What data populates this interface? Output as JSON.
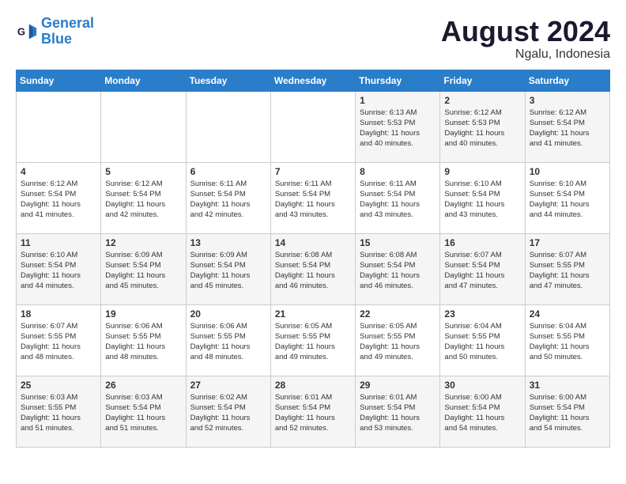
{
  "header": {
    "logo_line1": "General",
    "logo_line2": "Blue",
    "month_title": "August 2024",
    "location": "Ngalu, Indonesia"
  },
  "days_of_week": [
    "Sunday",
    "Monday",
    "Tuesday",
    "Wednesday",
    "Thursday",
    "Friday",
    "Saturday"
  ],
  "weeks": [
    [
      {
        "day": "",
        "info": ""
      },
      {
        "day": "",
        "info": ""
      },
      {
        "day": "",
        "info": ""
      },
      {
        "day": "",
        "info": ""
      },
      {
        "day": "1",
        "info": "Sunrise: 6:13 AM\nSunset: 5:53 PM\nDaylight: 11 hours\nand 40 minutes."
      },
      {
        "day": "2",
        "info": "Sunrise: 6:12 AM\nSunset: 5:53 PM\nDaylight: 11 hours\nand 40 minutes."
      },
      {
        "day": "3",
        "info": "Sunrise: 6:12 AM\nSunset: 5:54 PM\nDaylight: 11 hours\nand 41 minutes."
      }
    ],
    [
      {
        "day": "4",
        "info": "Sunrise: 6:12 AM\nSunset: 5:54 PM\nDaylight: 11 hours\nand 41 minutes."
      },
      {
        "day": "5",
        "info": "Sunrise: 6:12 AM\nSunset: 5:54 PM\nDaylight: 11 hours\nand 42 minutes."
      },
      {
        "day": "6",
        "info": "Sunrise: 6:11 AM\nSunset: 5:54 PM\nDaylight: 11 hours\nand 42 minutes."
      },
      {
        "day": "7",
        "info": "Sunrise: 6:11 AM\nSunset: 5:54 PM\nDaylight: 11 hours\nand 43 minutes."
      },
      {
        "day": "8",
        "info": "Sunrise: 6:11 AM\nSunset: 5:54 PM\nDaylight: 11 hours\nand 43 minutes."
      },
      {
        "day": "9",
        "info": "Sunrise: 6:10 AM\nSunset: 5:54 PM\nDaylight: 11 hours\nand 43 minutes."
      },
      {
        "day": "10",
        "info": "Sunrise: 6:10 AM\nSunset: 5:54 PM\nDaylight: 11 hours\nand 44 minutes."
      }
    ],
    [
      {
        "day": "11",
        "info": "Sunrise: 6:10 AM\nSunset: 5:54 PM\nDaylight: 11 hours\nand 44 minutes."
      },
      {
        "day": "12",
        "info": "Sunrise: 6:09 AM\nSunset: 5:54 PM\nDaylight: 11 hours\nand 45 minutes."
      },
      {
        "day": "13",
        "info": "Sunrise: 6:09 AM\nSunset: 5:54 PM\nDaylight: 11 hours\nand 45 minutes."
      },
      {
        "day": "14",
        "info": "Sunrise: 6:08 AM\nSunset: 5:54 PM\nDaylight: 11 hours\nand 46 minutes."
      },
      {
        "day": "15",
        "info": "Sunrise: 6:08 AM\nSunset: 5:54 PM\nDaylight: 11 hours\nand 46 minutes."
      },
      {
        "day": "16",
        "info": "Sunrise: 6:07 AM\nSunset: 5:54 PM\nDaylight: 11 hours\nand 47 minutes."
      },
      {
        "day": "17",
        "info": "Sunrise: 6:07 AM\nSunset: 5:55 PM\nDaylight: 11 hours\nand 47 minutes."
      }
    ],
    [
      {
        "day": "18",
        "info": "Sunrise: 6:07 AM\nSunset: 5:55 PM\nDaylight: 11 hours\nand 48 minutes."
      },
      {
        "day": "19",
        "info": "Sunrise: 6:06 AM\nSunset: 5:55 PM\nDaylight: 11 hours\nand 48 minutes."
      },
      {
        "day": "20",
        "info": "Sunrise: 6:06 AM\nSunset: 5:55 PM\nDaylight: 11 hours\nand 48 minutes."
      },
      {
        "day": "21",
        "info": "Sunrise: 6:05 AM\nSunset: 5:55 PM\nDaylight: 11 hours\nand 49 minutes."
      },
      {
        "day": "22",
        "info": "Sunrise: 6:05 AM\nSunset: 5:55 PM\nDaylight: 11 hours\nand 49 minutes."
      },
      {
        "day": "23",
        "info": "Sunrise: 6:04 AM\nSunset: 5:55 PM\nDaylight: 11 hours\nand 50 minutes."
      },
      {
        "day": "24",
        "info": "Sunrise: 6:04 AM\nSunset: 5:55 PM\nDaylight: 11 hours\nand 50 minutes."
      }
    ],
    [
      {
        "day": "25",
        "info": "Sunrise: 6:03 AM\nSunset: 5:55 PM\nDaylight: 11 hours\nand 51 minutes."
      },
      {
        "day": "26",
        "info": "Sunrise: 6:03 AM\nSunset: 5:54 PM\nDaylight: 11 hours\nand 51 minutes."
      },
      {
        "day": "27",
        "info": "Sunrise: 6:02 AM\nSunset: 5:54 PM\nDaylight: 11 hours\nand 52 minutes."
      },
      {
        "day": "28",
        "info": "Sunrise: 6:01 AM\nSunset: 5:54 PM\nDaylight: 11 hours\nand 52 minutes."
      },
      {
        "day": "29",
        "info": "Sunrise: 6:01 AM\nSunset: 5:54 PM\nDaylight: 11 hours\nand 53 minutes."
      },
      {
        "day": "30",
        "info": "Sunrise: 6:00 AM\nSunset: 5:54 PM\nDaylight: 11 hours\nand 54 minutes."
      },
      {
        "day": "31",
        "info": "Sunrise: 6:00 AM\nSunset: 5:54 PM\nDaylight: 11 hours\nand 54 minutes."
      }
    ]
  ]
}
